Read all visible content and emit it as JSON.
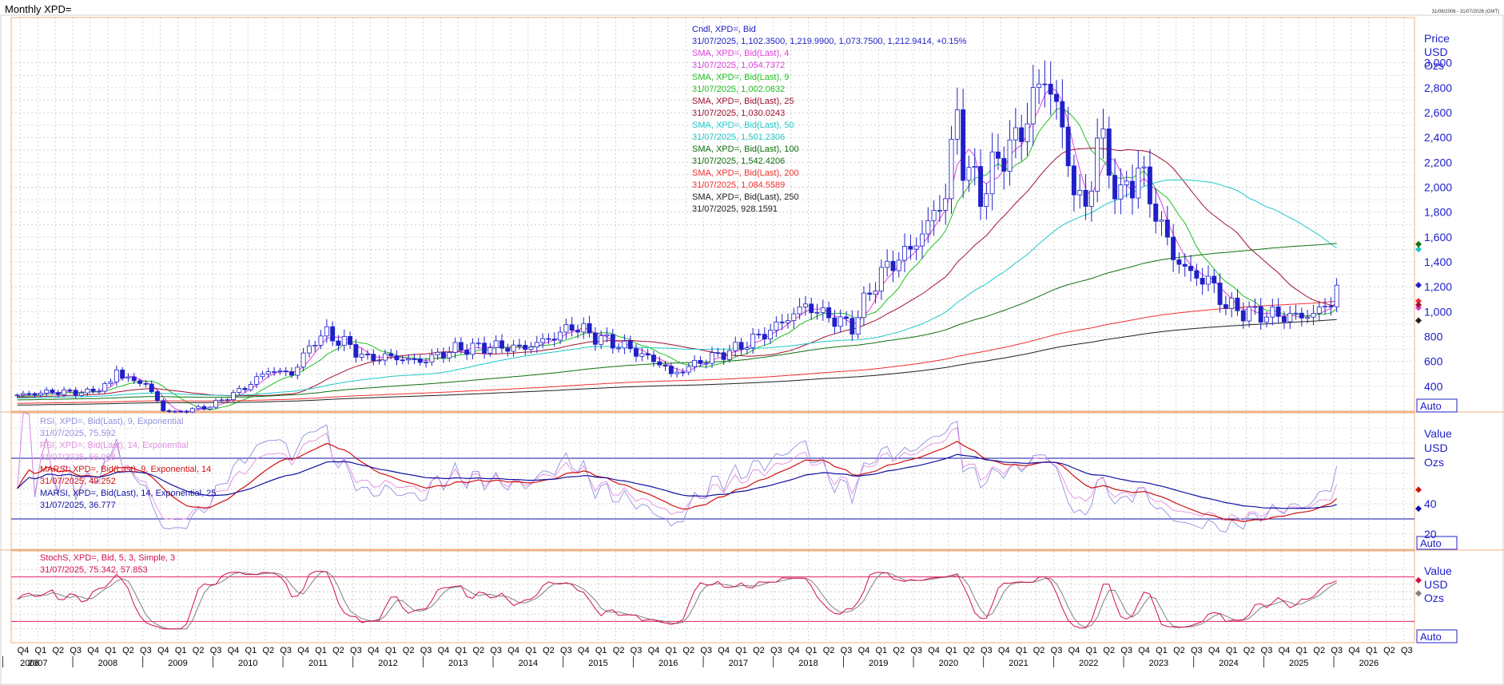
{
  "header": {
    "title": "Monthly XPD=",
    "date_range": "31/08/2006 - 31/07/2026 (GMT)"
  },
  "colors": {
    "grid": "#c8c8c8",
    "frame": "#f0b080",
    "candle": "#2020c8",
    "sma4": "#e040e0",
    "sma9": "#20c020",
    "sma25": "#a01030",
    "sma50": "#20c8c8",
    "sma100": "#107010",
    "sma200": "#f03030",
    "sma250": "#202020",
    "rsi9": "#9090e0",
    "rsi14": "#e090e0",
    "marsi9": "#d01010",
    "marsi14": "#1010a0",
    "stoch_k": "#d01050",
    "stoch_d": "#808080",
    "level_line_rsi": "#1010a0",
    "level_line_stoch": "#e02070",
    "axis_text": "#2020c8"
  },
  "price_legend": [
    {
      "label": "Cndl, XPD=, Bid",
      "color": "#2020c8"
    },
    {
      "label": "31/07/2025, 1,102.3500, 1,219.9900, 1,073.7500, 1,212.9414, +0.15%",
      "color": "#2020c8"
    },
    {
      "label": "SMA, XPD=, Bid(Last), 4",
      "color": "#e040e0"
    },
    {
      "label": "31/07/2025, 1,054.7372",
      "color": "#e040e0"
    },
    {
      "label": "SMA, XPD=, Bid(Last), 9",
      "color": "#20c020"
    },
    {
      "label": "31/07/2025, 1,002.0632",
      "color": "#20c020"
    },
    {
      "label": "SMA, XPD=, Bid(Last), 25",
      "color": "#a01030"
    },
    {
      "label": "31/07/2025, 1,030.0243",
      "color": "#a01030"
    },
    {
      "label": "SMA, XPD=, Bid(Last), 50",
      "color": "#20c8c8"
    },
    {
      "label": "31/07/2025, 1,501.2306",
      "color": "#20c8c8"
    },
    {
      "label": "SMA, XPD=, Bid(Last), 100",
      "color": "#107010"
    },
    {
      "label": "31/07/2025, 1,542.4206",
      "color": "#107010"
    },
    {
      "label": "SMA, XPD=, Bid(Last), 200",
      "color": "#f03030"
    },
    {
      "label": "31/07/2025, 1,084.5589",
      "color": "#f03030"
    },
    {
      "label": "SMA, XPD=, Bid(Last), 250",
      "color": "#202020"
    },
    {
      "label": "31/07/2025, 928.1591",
      "color": "#202020"
    }
  ],
  "rsi_legend": [
    {
      "label": "RSI, XPD=, Bid(Last), 9, Exponential",
      "color": "#9090e0"
    },
    {
      "label": "31/07/2025, 75.592",
      "color": "#9090e0"
    },
    {
      "label": "RSI, XPD=, Bid(Last), 14, Exponential",
      "color": "#e090e0"
    },
    {
      "label": "31/07/2025, 66.068",
      "color": "#e090e0"
    },
    {
      "label": "MARSI, XPD=, Bid(Last), 9, Exponential, 14",
      "color": "#d01010"
    },
    {
      "label": "31/07/2025, 49.252",
      "color": "#d01010"
    },
    {
      "label": "MARSI, XPD=, Bid(Last), 14, Exponential, 25",
      "color": "#1010a0"
    },
    {
      "label": "31/07/2025, 36.777",
      "color": "#1010a0"
    }
  ],
  "stoch_legend": [
    {
      "label": "StochS, XPD=, Bid, 5, 3, Simple, 3",
      "color": "#d01050"
    },
    {
      "label": "31/07/2025, 75.342, 57.853",
      "color": "#d01050"
    }
  ],
  "price_axis": {
    "caption": [
      "Price",
      "USD",
      "Ozs"
    ],
    "ticks": [
      "400",
      "600",
      "800",
      "1,000",
      "1,200",
      "1,400",
      "1,600",
      "1,800",
      "2,000",
      "2,200",
      "2,400",
      "2,600",
      "2,800",
      "3,000"
    ],
    "tick_values": [
      400,
      600,
      800,
      1000,
      1200,
      1400,
      1600,
      1800,
      2000,
      2200,
      2400,
      2600,
      2800,
      3000
    ],
    "auto_label": "Auto"
  },
  "rsi_axis": {
    "caption": [
      "Value",
      "USD",
      "Ozs"
    ],
    "ticks": [
      "20",
      "40"
    ],
    "tick_values": [
      20,
      40
    ],
    "auto_label": "Auto"
  },
  "stoch_axis": {
    "caption": [
      "Value",
      "USD",
      "Ozs"
    ],
    "auto_label": "Auto"
  },
  "time_axis": {
    "quarters": [
      "Q4",
      "Q1",
      "Q2",
      "Q3",
      "Q4",
      "Q1",
      "Q2",
      "Q3",
      "Q4",
      "Q1",
      "Q2",
      "Q3",
      "Q4",
      "Q1",
      "Q2",
      "Q3",
      "Q4",
      "Q1",
      "Q2",
      "Q3",
      "Q4",
      "Q1",
      "Q2",
      "Q3",
      "Q4",
      "Q1",
      "Q2",
      "Q3",
      "Q4",
      "Q1",
      "Q2",
      "Q3",
      "Q4",
      "Q1",
      "Q2",
      "Q3",
      "Q4",
      "Q1",
      "Q2",
      "Q3",
      "Q4",
      "Q1",
      "Q2",
      "Q3",
      "Q4",
      "Q1",
      "Q2",
      "Q3",
      "Q4",
      "Q1",
      "Q2",
      "Q3",
      "Q4",
      "Q1",
      "Q2",
      "Q3",
      "Q4",
      "Q1",
      "Q2",
      "Q3",
      "Q4",
      "Q1",
      "Q2",
      "Q3",
      "Q4",
      "Q1",
      "Q2",
      "Q3",
      "Q4",
      "Q1",
      "Q2",
      "Q3",
      "Q4",
      "Q1",
      "Q2",
      "Q3",
      "Q4",
      "Q1",
      "Q2",
      "Q3"
    ],
    "years": [
      "2006",
      "2007",
      "2008",
      "2009",
      "2010",
      "2011",
      "2012",
      "2013",
      "2014",
      "2015",
      "2016",
      "2017",
      "2018",
      "2019",
      "2020",
      "2021",
      "2022",
      "2023",
      "2024",
      "2025",
      "2026"
    ]
  },
  "chart_data": [
    {
      "type": "candlestick",
      "title": "Monthly XPD=",
      "x_range": [
        "2006-09",
        "2026-08"
      ],
      "ylim": [
        200,
        3300
      ],
      "price_anchors": [
        [
          "2006-09",
          330
        ],
        [
          "2007-03",
          355
        ],
        [
          "2007-09",
          350
        ],
        [
          "2008-01",
          420
        ],
        [
          "2008-02",
          560
        ],
        [
          "2008-03",
          470
        ],
        [
          "2008-07",
          420
        ],
        [
          "2008-10",
          210
        ],
        [
          "2008-12",
          190
        ],
        [
          "2009-06",
          240
        ],
        [
          "2009-12",
          390
        ],
        [
          "2010-04",
          530
        ],
        [
          "2010-08",
          500
        ],
        [
          "2010-12",
          780
        ],
        [
          "2011-02",
          820
        ],
        [
          "2011-05",
          750
        ],
        [
          "2011-09",
          620
        ],
        [
          "2011-12",
          640
        ],
        [
          "2012-06",
          600
        ],
        [
          "2012-12",
          700
        ],
        [
          "2013-06",
          720
        ],
        [
          "2013-12",
          710
        ],
        [
          "2014-06",
          820
        ],
        [
          "2014-08",
          890
        ],
        [
          "2014-12",
          800
        ],
        [
          "2015-06",
          700
        ],
        [
          "2015-12",
          560
        ],
        [
          "2016-01",
          490
        ],
        [
          "2016-06",
          600
        ],
        [
          "2016-12",
          700
        ],
        [
          "2017-06",
          850
        ],
        [
          "2017-12",
          1050
        ],
        [
          "2018-03",
          980
        ],
        [
          "2018-08",
          880
        ],
        [
          "2018-12",
          1250
        ],
        [
          "2019-03",
          1400
        ],
        [
          "2019-06",
          1500
        ],
        [
          "2019-09",
          1700
        ],
        [
          "2019-12",
          1950
        ],
        [
          "2020-02",
          2600
        ],
        [
          "2020-03",
          2200
        ],
        [
          "2020-06",
          1950
        ],
        [
          "2020-10",
          2300
        ],
        [
          "2020-12",
          2350
        ],
        [
          "2021-03",
          2700
        ],
        [
          "2021-05",
          2900
        ],
        [
          "2021-07",
          2650
        ],
        [
          "2021-10",
          2000
        ],
        [
          "2021-12",
          1800
        ],
        [
          "2022-02",
          2400
        ],
        [
          "2022-03",
          2300
        ],
        [
          "2022-06",
          1900
        ],
        [
          "2022-09",
          2150
        ],
        [
          "2022-12",
          1800
        ],
        [
          "2023-03",
          1450
        ],
        [
          "2023-06",
          1300
        ],
        [
          "2023-09",
          1250
        ],
        [
          "2023-12",
          1050
        ],
        [
          "2024-03",
          1000
        ],
        [
          "2024-06",
          980
        ],
        [
          "2024-09",
          970
        ],
        [
          "2024-12",
          960
        ],
        [
          "2025-03",
          980
        ],
        [
          "2025-06",
          1080
        ],
        [
          "2025-07",
          1213
        ]
      ],
      "last_candle": {
        "date": "31/07/2025",
        "open": 1102.35,
        "high": 1219.99,
        "low": 1073.75,
        "close": 1212.9414
      },
      "series": [
        {
          "name": "SMA, XPD=, Bid(Last), 4",
          "last": 1054.7372
        },
        {
          "name": "SMA, XPD=, Bid(Last), 9",
          "last": 1002.0632
        },
        {
          "name": "SMA, XPD=, Bid(Last), 25",
          "last": 1030.0243
        },
        {
          "name": "SMA, XPD=, Bid(Last), 50",
          "last": 1501.2306
        },
        {
          "name": "SMA, XPD=, Bid(Last), 100",
          "last": 1542.4206
        },
        {
          "name": "SMA, XPD=, Bid(Last), 200",
          "last": 1084.5589
        },
        {
          "name": "SMA, XPD=, Bid(Last), 250",
          "last": 928.1591
        }
      ],
      "grid": true
    },
    {
      "type": "line",
      "ylim": [
        10,
        100
      ],
      "levels": [
        30,
        70
      ],
      "series": [
        {
          "name": "RSI, XPD=, Bid(Last), 9, Exponential",
          "last": 75.592
        },
        {
          "name": "RSI, XPD=, Bid(Last), 14, Exponential",
          "last": 66.068
        },
        {
          "name": "MARSI, XPD=, Bid(Last), 9, Exponential, 14",
          "last": 49.252
        },
        {
          "name": "MARSI, XPD=, Bid(Last), 14, Exponential, 25",
          "last": 36.777
        }
      ],
      "grid": true
    },
    {
      "type": "line",
      "ylim": [
        0,
        100
      ],
      "levels": [
        20,
        80
      ],
      "series": [
        {
          "name": "StochS %K",
          "last": 75.342
        },
        {
          "name": "StochS %D",
          "last": 57.853
        }
      ],
      "grid": true
    }
  ]
}
